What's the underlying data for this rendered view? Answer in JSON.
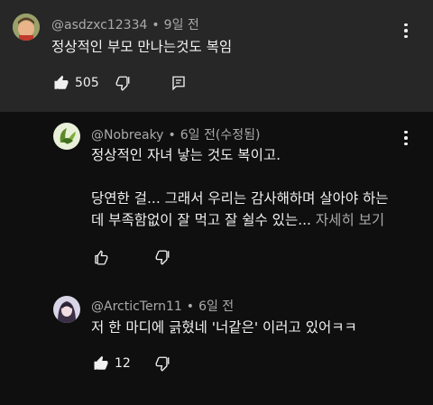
{
  "comment": {
    "author": "@asdzxc12334",
    "separator": "•",
    "time": "9일 전",
    "text": "정상적인 부모 만나는것도 복임",
    "likes": "505",
    "like_icon": "thumb-up-filled-icon",
    "dislike_icon": "thumb-down-icon",
    "reply_icon": "reply-icon",
    "menu_icon": "more-vertical-icon"
  },
  "replies": [
    {
      "author": "@Nobreaky",
      "separator": "•",
      "time": "6일 전(수정됨)",
      "lines": [
        "정상적인 자녀 낳는 것도 복이고.",
        "",
        "당연한 걸... 그래서 우리는 감사해하며 살아야 하는",
        "데 부족함없이 잘 먹고 잘 쉴수 있는... "
      ],
      "more_label": "자세히 보기",
      "likes": ""
    },
    {
      "author": "@ArcticTern11",
      "separator": "•",
      "time": "6일 전",
      "lines": [
        "저 한 마디에 긁혔네 '너같은' 이러고 있어ㅋㅋ"
      ],
      "likes": "12"
    }
  ],
  "colors": {
    "top_background": "#272727",
    "page_background": "#0f0f0f",
    "text_primary": "#f1f1f1",
    "text_secondary": "#aaaaaa"
  }
}
